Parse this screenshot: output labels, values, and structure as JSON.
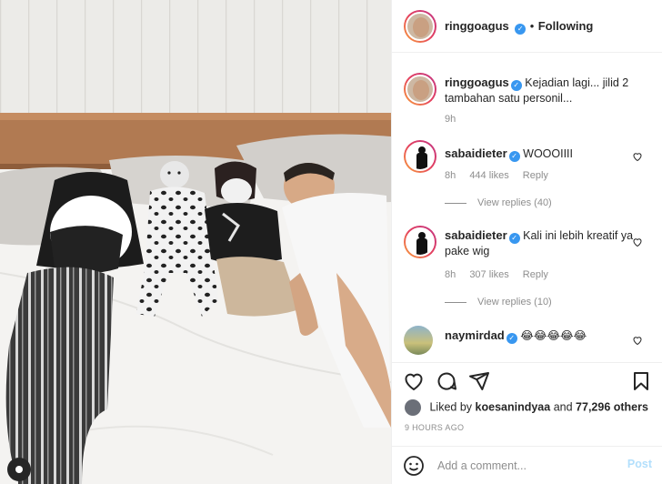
{
  "post": {
    "author": "ringgoagus",
    "follow_separator": "•",
    "follow_status": "Following"
  },
  "caption": {
    "username": "ringgoagus",
    "text": "Kejadian lagi... jilid 2 tambahan satu personil...",
    "time": "9h"
  },
  "comments": [
    {
      "username": "sabaidieter",
      "text": "WOOOIIII",
      "time": "8h",
      "likes": "444 likes",
      "reply_label": "Reply",
      "view_replies": "View replies (40)"
    },
    {
      "username": "sabaidieter",
      "text": "Kali ini lebih kreatif ya pake wig",
      "time": "8h",
      "likes": "307 likes",
      "reply_label": "Reply",
      "view_replies": "View replies (10)"
    },
    {
      "username": "naymirdad",
      "text": "😂😂😂😂😂"
    }
  ],
  "likes": {
    "prefix": "Liked by",
    "user": "koesanindyaa",
    "middle": "and",
    "count": "77,296 others"
  },
  "timestamp": "9 HOURS AGO",
  "composer": {
    "placeholder": "Add a comment...",
    "post_label": "Post"
  },
  "colors": {
    "verified": "#3897f0",
    "meta": "#8e8e8e",
    "post_disabled": "#b2dffc"
  },
  "icons": [
    "verified-badge-icon",
    "heart-icon",
    "comment-icon",
    "share-icon",
    "bookmark-icon",
    "emoji-icon"
  ]
}
